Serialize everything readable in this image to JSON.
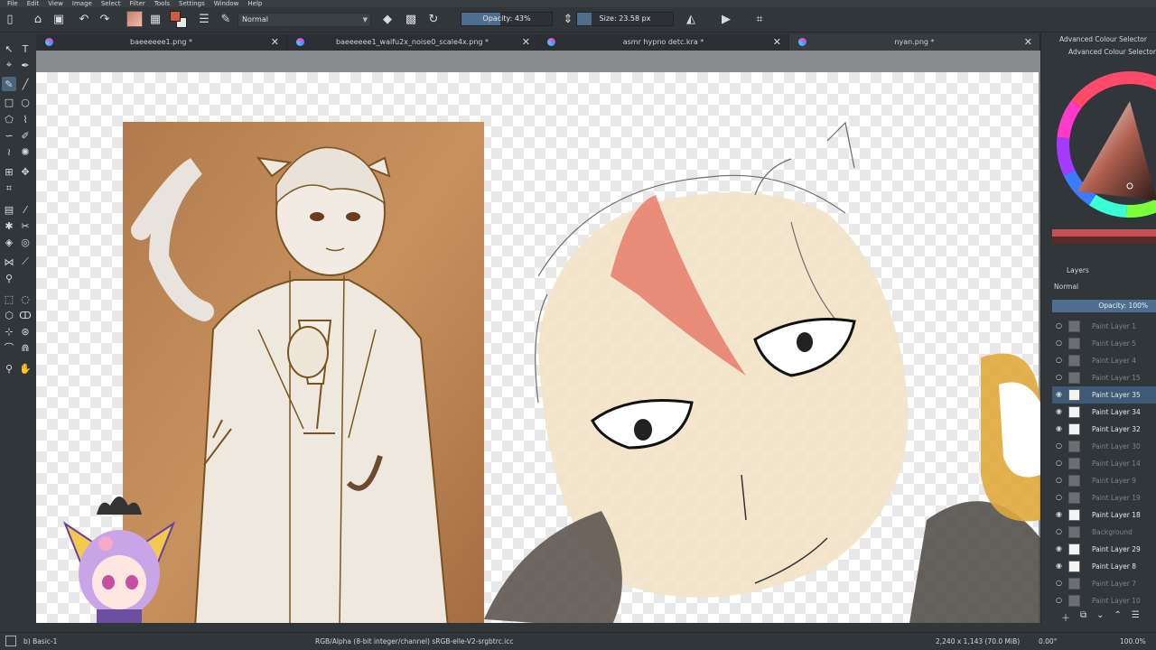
{
  "menu": [
    "File",
    "Edit",
    "View",
    "Image",
    "Select",
    "Filter",
    "Tools",
    "Settings",
    "Window",
    "Help"
  ],
  "toolbar": {
    "blend_mode": "Normal",
    "opacity_label": "Opacity: 43%",
    "opacity_value": 43,
    "size_label": "Size: 23.58 px",
    "size_fill_fraction": 0.15,
    "foreground_color": "#d15a3c",
    "background_color": "#e8e8e8"
  },
  "tabs": [
    {
      "label": "baeeeeee1.png *",
      "active": false
    },
    {
      "label": "baeeeeee1_waifu2x_noise0_scale4x.png *",
      "active": false
    },
    {
      "label": "asmr hypno detc.kra *",
      "active": false
    },
    {
      "label": "nyan.png *",
      "active": true
    }
  ],
  "docker": {
    "title": "Advanced Colour Selector",
    "subtitle": "Advanced Colour Selector",
    "layers_title": "Layers",
    "layers_blend": "Normal",
    "layers_opacity": "Opacity:  100%"
  },
  "layers": [
    {
      "name": "Paint Layer 1",
      "visible": false,
      "selected": false
    },
    {
      "name": "Paint Layer 5",
      "visible": false,
      "selected": false
    },
    {
      "name": "Paint Layer 4",
      "visible": false,
      "selected": false
    },
    {
      "name": "Paint Layer 15",
      "visible": false,
      "selected": false
    },
    {
      "name": "Paint Layer 35",
      "visible": true,
      "selected": true
    },
    {
      "name": "Paint Layer 34",
      "visible": true,
      "selected": false
    },
    {
      "name": "Paint Layer 32",
      "visible": true,
      "selected": false
    },
    {
      "name": "Paint Layer 30",
      "visible": false,
      "selected": false
    },
    {
      "name": "Paint Layer 14",
      "visible": false,
      "selected": false
    },
    {
      "name": "Paint Layer 9",
      "visible": false,
      "selected": false
    },
    {
      "name": "Paint Layer 19",
      "visible": false,
      "selected": false
    },
    {
      "name": "Paint Layer 18",
      "visible": true,
      "selected": false
    },
    {
      "name": "Background",
      "visible": false,
      "selected": false
    },
    {
      "name": "Paint Layer 29",
      "visible": true,
      "selected": false
    },
    {
      "name": "Paint Layer 8",
      "visible": true,
      "selected": false
    },
    {
      "name": "Paint Layer 7",
      "visible": false,
      "selected": false
    },
    {
      "name": "Paint Layer 10",
      "visible": false,
      "selected": false
    }
  ],
  "status": {
    "preset": "b) Basic-1",
    "color_info": "RGB/Alpha (8-bit integer/channel)  sRGB-elle-V2-srgbtrc.icc",
    "coords": "2,240 x 1,143 (70.0 MiB)",
    "rotation": "0.00°",
    "zoom": "100.0%"
  },
  "icons": [
    "new-document-icon",
    "open-icon",
    "save-icon",
    "undo-icon",
    "redo-icon",
    "eraser-icon",
    "pattern-icon",
    "reload-icon",
    "mirror-horizontal-icon",
    "mirror-vertical-icon",
    "crop-icon"
  ]
}
